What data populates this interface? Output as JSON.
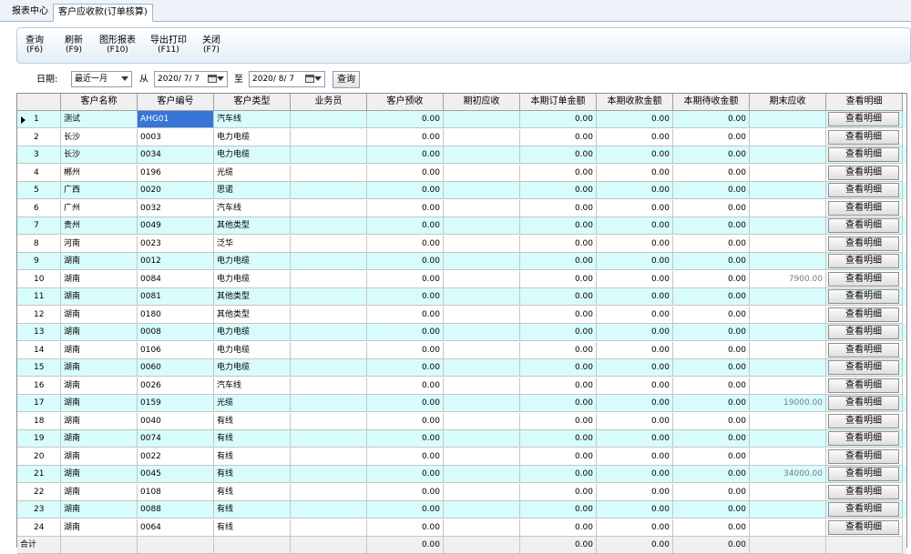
{
  "tabs": [
    "报表中心",
    "客户应收款(订单核算)"
  ],
  "toolbar": [
    {
      "label": "查询",
      "key": "(F6)"
    },
    {
      "label": "刷新",
      "key": "(F9)"
    },
    {
      "label": "图形报表",
      "key": "(F10)"
    },
    {
      "label": "导出打印",
      "key": "(F11)"
    },
    {
      "label": "关闭",
      "key": "(F7)"
    }
  ],
  "filter": {
    "date_label": "日期:",
    "period": "最近一月",
    "from_label": "从",
    "from_date": "2020/ 7/ 7",
    "to_label": "至",
    "to_date": "2020/ 8/ 7",
    "query": "查询"
  },
  "columns": [
    "",
    "客户名称",
    "客户编号",
    "客户类型",
    "业务员",
    "客户预收",
    "期初应收",
    "本期订单金额",
    "本期收款金额",
    "本期待收金额",
    "期末应收",
    "查看明细"
  ],
  "rows": [
    {
      "no": "1",
      "name": "测试",
      "code": "AHG01",
      "type": "汽车线",
      "sales": "",
      "prepay": "0.00",
      "opening": "",
      "order": "0.00",
      "received": "0.00",
      "pending": "0.00",
      "closing": ""
    },
    {
      "no": "2",
      "name": "长沙",
      "code": "0003",
      "type": "电力电缆",
      "sales": "",
      "prepay": "0.00",
      "opening": "",
      "order": "0.00",
      "received": "0.00",
      "pending": "0.00",
      "closing": ""
    },
    {
      "no": "3",
      "name": "长沙",
      "code": "0034",
      "type": "电力电缆",
      "sales": "",
      "prepay": "0.00",
      "opening": "",
      "order": "0.00",
      "received": "0.00",
      "pending": "0.00",
      "closing": ""
    },
    {
      "no": "4",
      "name": "郴州",
      "code": "0196",
      "type": "光缆",
      "sales": "",
      "prepay": "0.00",
      "opening": "",
      "order": "0.00",
      "received": "0.00",
      "pending": "0.00",
      "closing": ""
    },
    {
      "no": "5",
      "name": "广西",
      "code": "0020",
      "type": "思诺",
      "sales": "",
      "prepay": "0.00",
      "opening": "",
      "order": "0.00",
      "received": "0.00",
      "pending": "0.00",
      "closing": ""
    },
    {
      "no": "6",
      "name": "广州",
      "code": "0032",
      "type": "汽车线",
      "sales": "",
      "prepay": "0.00",
      "opening": "",
      "order": "0.00",
      "received": "0.00",
      "pending": "0.00",
      "closing": ""
    },
    {
      "no": "7",
      "name": "贵州",
      "code": "0049",
      "type": "其他类型",
      "sales": "",
      "prepay": "0.00",
      "opening": "",
      "order": "0.00",
      "received": "0.00",
      "pending": "0.00",
      "closing": ""
    },
    {
      "no": "8",
      "name": "河南",
      "code": "0023",
      "type": "泛华",
      "sales": "",
      "prepay": "0.00",
      "opening": "",
      "order": "0.00",
      "received": "0.00",
      "pending": "0.00",
      "closing": ""
    },
    {
      "no": "9",
      "name": "湖南",
      "code": "0012",
      "type": "电力电缆",
      "sales": "",
      "prepay": "0.00",
      "opening": "",
      "order": "0.00",
      "received": "0.00",
      "pending": "0.00",
      "closing": ""
    },
    {
      "no": "10",
      "name": "湖南",
      "code": "0084",
      "type": "电力电缆",
      "sales": "",
      "prepay": "0.00",
      "opening": "",
      "order": "0.00",
      "received": "0.00",
      "pending": "0.00",
      "closing": "7900.00"
    },
    {
      "no": "11",
      "name": "湖南",
      "code": "0081",
      "type": "其他类型",
      "sales": "",
      "prepay": "0.00",
      "opening": "",
      "order": "0.00",
      "received": "0.00",
      "pending": "0.00",
      "closing": ""
    },
    {
      "no": "12",
      "name": "湖南",
      "code": "0180",
      "type": "其他类型",
      "sales": "",
      "prepay": "0.00",
      "opening": "",
      "order": "0.00",
      "received": "0.00",
      "pending": "0.00",
      "closing": ""
    },
    {
      "no": "13",
      "name": "湖南",
      "code": "0008",
      "type": "电力电缆",
      "sales": "",
      "prepay": "0.00",
      "opening": "",
      "order": "0.00",
      "received": "0.00",
      "pending": "0.00",
      "closing": ""
    },
    {
      "no": "14",
      "name": "湖南",
      "code": "0106",
      "type": "电力电缆",
      "sales": "",
      "prepay": "0.00",
      "opening": "",
      "order": "0.00",
      "received": "0.00",
      "pending": "0.00",
      "closing": ""
    },
    {
      "no": "15",
      "name": "湖南",
      "code": "0060",
      "type": "电力电缆",
      "sales": "",
      "prepay": "0.00",
      "opening": "",
      "order": "0.00",
      "received": "0.00",
      "pending": "0.00",
      "closing": ""
    },
    {
      "no": "16",
      "name": "湖南",
      "code": "0026",
      "type": "汽车线",
      "sales": "",
      "prepay": "0.00",
      "opening": "",
      "order": "0.00",
      "received": "0.00",
      "pending": "0.00",
      "closing": ""
    },
    {
      "no": "17",
      "name": "湖南",
      "code": "0159",
      "type": "光缆",
      "sales": "",
      "prepay": "0.00",
      "opening": "",
      "order": "0.00",
      "received": "0.00",
      "pending": "0.00",
      "closing": "19000.00"
    },
    {
      "no": "18",
      "name": "湖南",
      "code": "0040",
      "type": "有线",
      "sales": "",
      "prepay": "0.00",
      "opening": "",
      "order": "0.00",
      "received": "0.00",
      "pending": "0.00",
      "closing": ""
    },
    {
      "no": "19",
      "name": "湖南",
      "code": "0074",
      "type": "有线",
      "sales": "",
      "prepay": "0.00",
      "opening": "",
      "order": "0.00",
      "received": "0.00",
      "pending": "0.00",
      "closing": ""
    },
    {
      "no": "20",
      "name": "湖南",
      "code": "0022",
      "type": "有线",
      "sales": "",
      "prepay": "0.00",
      "opening": "",
      "order": "0.00",
      "received": "0.00",
      "pending": "0.00",
      "closing": ""
    },
    {
      "no": "21",
      "name": "湖南",
      "code": "0045",
      "type": "有线",
      "sales": "",
      "prepay": "0.00",
      "opening": "",
      "order": "0.00",
      "received": "0.00",
      "pending": "0.00",
      "closing": "34000.00"
    },
    {
      "no": "22",
      "name": "湖南",
      "code": "0108",
      "type": "有线",
      "sales": "",
      "prepay": "0.00",
      "opening": "",
      "order": "0.00",
      "received": "0.00",
      "pending": "0.00",
      "closing": ""
    },
    {
      "no": "23",
      "name": "湖南",
      "code": "0088",
      "type": "有线",
      "sales": "",
      "prepay": "0.00",
      "opening": "",
      "order": "0.00",
      "received": "0.00",
      "pending": "0.00",
      "closing": ""
    },
    {
      "no": "24",
      "name": "湖南",
      "code": "0064",
      "type": "有线",
      "sales": "",
      "prepay": "0.00",
      "opening": "",
      "order": "0.00",
      "received": "0.00",
      "pending": "0.00",
      "closing": ""
    }
  ],
  "detail_label": "查看明细",
  "total": {
    "label": "合计",
    "prepay": "0.00",
    "opening": "",
    "order": "0.00",
    "received": "0.00",
    "pending": "0.00",
    "closing": ""
  }
}
